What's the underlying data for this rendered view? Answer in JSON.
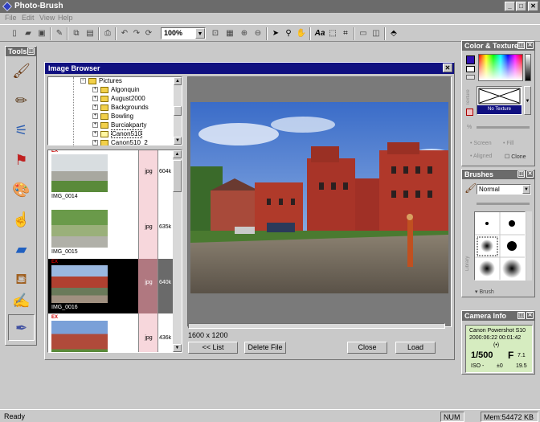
{
  "app": {
    "title": "Photo-Brush"
  },
  "window_controls": {
    "minimize": "_",
    "maximize": "□",
    "close": "✕"
  },
  "menu": [
    "File",
    "Edit",
    "View",
    "Help"
  ],
  "toolbar": {
    "zoom_value": "100%"
  },
  "tools_panel": {
    "title": "Tools"
  },
  "image_browser": {
    "title": "Image Browser",
    "close": "✕",
    "folders": [
      {
        "label": "Pictures",
        "level": 0,
        "expander": "−"
      },
      {
        "label": "Algonquin",
        "level": 1,
        "expander": "+"
      },
      {
        "label": "August2000",
        "level": 1,
        "expander": "+"
      },
      {
        "label": "Backgrounds",
        "level": 1,
        "expander": "+"
      },
      {
        "label": "Bowling",
        "level": 1,
        "expander": "+"
      },
      {
        "label": "Burciakparty",
        "level": 1,
        "expander": "+"
      },
      {
        "label": "Canon510",
        "level": 1,
        "expander": "+",
        "selected": true
      },
      {
        "label": "Canon510_2",
        "level": 1,
        "expander": "+"
      }
    ],
    "thumbnails": [
      {
        "name": "IMG_0014",
        "format": "jpg",
        "size": "604k",
        "exif": "EX",
        "selected": false
      },
      {
        "name": "IMG_0015",
        "format": "jpg",
        "size": "635k",
        "exif": "",
        "selected": false
      },
      {
        "name": "IMG_0016",
        "format": "jpg",
        "size": "640k",
        "exif": "EX",
        "selected": true
      },
      {
        "name": "",
        "format": "jpg",
        "size": "436k",
        "exif": "EX",
        "selected": false
      }
    ],
    "dimensions": "1600 x 1200",
    "buttons": {
      "list": "<< List",
      "delete": "Delete File",
      "close": "Close",
      "load": "Load"
    }
  },
  "color_panel": {
    "title": "Color & Texture",
    "texture_label": "Texture",
    "no_texture": "No Texture",
    "screen": "Screen",
    "fill": "Fill",
    "aligned": "Aligned",
    "clone": "Clone",
    "percent": "%"
  },
  "brushes_panel": {
    "title": "Brushes",
    "mode": "Normal",
    "library": "Library",
    "brush": "Brush"
  },
  "camera_panel": {
    "title": "Camera Info",
    "model": "Canon Powershot S10",
    "datetime": "2000:06:22 00:01:42",
    "flash": "(•)",
    "shutter": "1/500",
    "aperture_label": "F",
    "aperture": "7.1",
    "iso": "ISO -",
    "ev": "±0",
    "focal": "19.5"
  },
  "status": {
    "text": "Ready",
    "num": "NUM",
    "mem": "Mem:54472 KB"
  },
  "colors": {
    "title_active": "#101080",
    "title_inactive": "#6b6b6b",
    "face": "#c9c9c9",
    "camera_lcd": "#d6ecc0"
  }
}
